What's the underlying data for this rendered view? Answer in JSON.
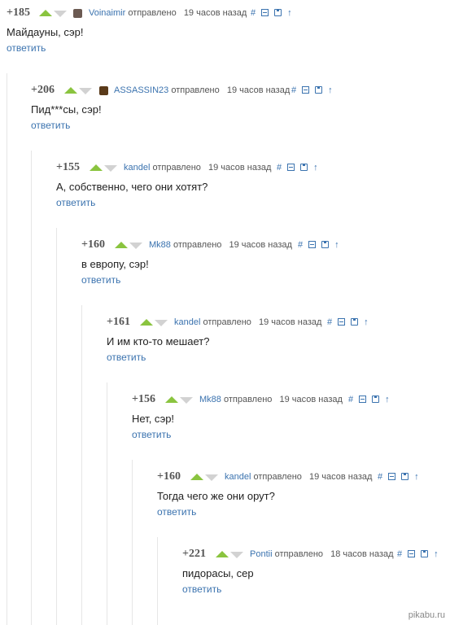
{
  "comments": [
    {
      "rating": "+185",
      "author": "Voinaimir",
      "sent": "отправлено",
      "time": "19 часов назад",
      "text": "Майдауны, сэр!",
      "reply": "ответить",
      "avatar_color": "#6b5a52"
    },
    {
      "rating": "+206",
      "author": "ASSASSIN23",
      "sent": "отправлено",
      "time": "19 часов назад",
      "text": "Пид***сы, сэр!",
      "reply": "ответить",
      "avatar_color": "#5a3a1a"
    },
    {
      "rating": "+155",
      "author": "kandel",
      "sent": "отправлено",
      "time": "19 часов назад",
      "text": "А, собственно, чего они хотят?",
      "reply": "ответить"
    },
    {
      "rating": "+160",
      "author": "Mk88",
      "sent": "отправлено",
      "time": "19 часов назад",
      "text": "в европу, сэр!",
      "reply": "ответить"
    },
    {
      "rating": "+161",
      "author": "kandel",
      "sent": "отправлено",
      "time": "19 часов назад",
      "text": "И им кто-то мешает?",
      "reply": "ответить"
    },
    {
      "rating": "+156",
      "author": "Mk88",
      "sent": "отправлено",
      "time": "19 часов назад",
      "text": "Нет, сэр!",
      "reply": "ответить"
    },
    {
      "rating": "+160",
      "author": "kandel",
      "sent": "отправлено",
      "time": "19 часов назад",
      "text": "Тогда чего же они орут?",
      "reply": "ответить"
    },
    {
      "rating": "+221",
      "author": "Pontii",
      "sent": "отправлено",
      "time": "18 часов назад",
      "text": "пидорасы, сер",
      "reply": "ответить"
    }
  ],
  "icons": {
    "link": "#",
    "collapse": "minus-icon",
    "save": "save-icon",
    "parent": "↑"
  },
  "watermark": "pikabu.ru",
  "colors": {
    "upvote": "#8ac43f",
    "downvote": "#d2d2d2",
    "link": "#3b73af"
  }
}
